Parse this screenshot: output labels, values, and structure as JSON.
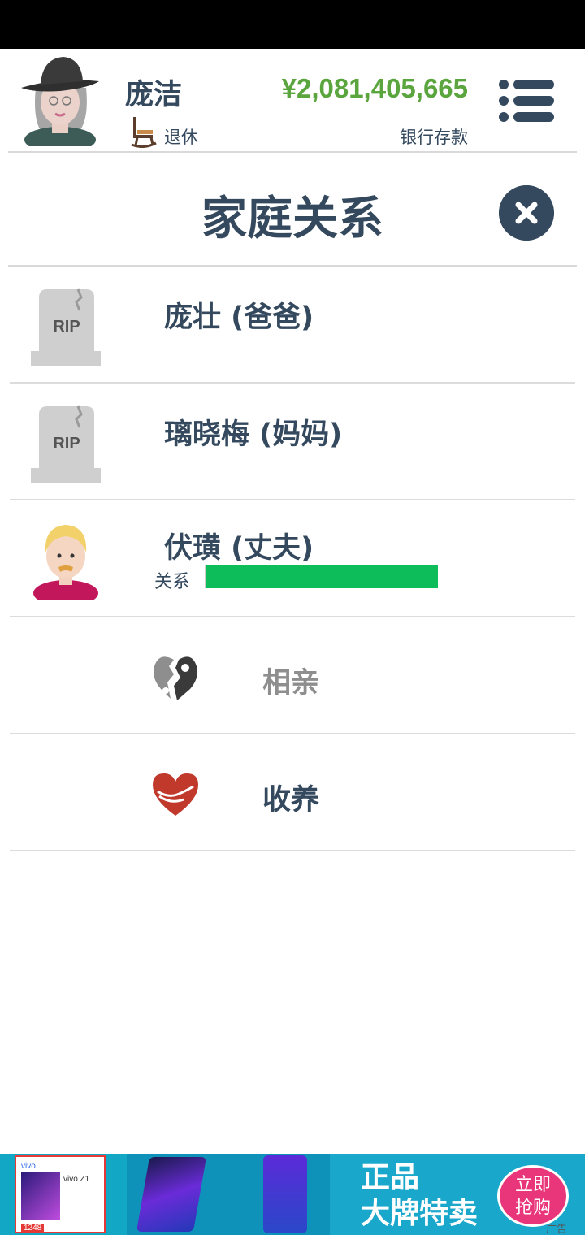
{
  "character": {
    "name": "庞洁",
    "status": "退休",
    "money": "¥2,081,405,665",
    "money_label": "银行存款"
  },
  "page": {
    "title": "家庭关系"
  },
  "relatives": [
    {
      "name": "庞壮 (爸爸)",
      "deceased": true,
      "grave_text": "RIP"
    },
    {
      "name": "璃晓梅 (妈妈)",
      "deceased": true,
      "grave_text": "RIP"
    },
    {
      "name": "伏璜 (丈夫)",
      "deceased": false,
      "relationship_label": "关系",
      "relationship_level": 0.99
    }
  ],
  "actions": [
    {
      "label": "相亲",
      "enabled": false,
      "color": "#8e8e8e",
      "icon": "broken-heart-icon"
    },
    {
      "label": "收养",
      "enabled": true,
      "color": "#34495e",
      "icon": "adopt-heart-icon"
    }
  ],
  "ad": {
    "brand": "vivo",
    "model": "vivo Z1",
    "price": "1248",
    "headline_line1": "正品",
    "headline_line2": "大牌特卖",
    "button_line1": "立即",
    "button_line2": "抢购",
    "tag": "广告"
  },
  "colors": {
    "primary": "#34495e",
    "money": "#5aa53e",
    "relationship_bar": "#0dbd5a",
    "disabled": "#8e8e8e",
    "heart": "#c0392b"
  }
}
